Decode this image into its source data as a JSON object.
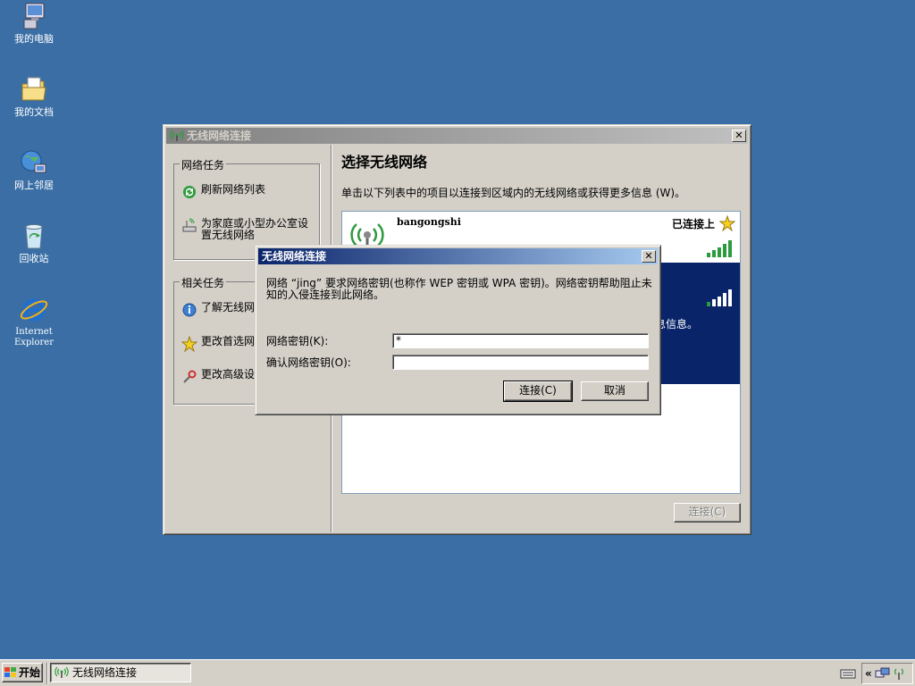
{
  "desktop": {
    "icons": [
      {
        "label": "我的电脑",
        "icon": "my-computer-icon"
      },
      {
        "label": "我的文档",
        "icon": "my-documents-icon"
      },
      {
        "label": "网上邻居",
        "icon": "network-places-icon"
      },
      {
        "label": "回收站",
        "icon": "recycle-bin-icon"
      },
      {
        "label": "Internet Explorer",
        "icon": "internet-explorer-icon"
      }
    ]
  },
  "wireless_window": {
    "title": "无线网络连接",
    "network_tasks": {
      "title": "网络任务",
      "items": [
        {
          "label": "刷新网络列表",
          "icon": "refresh-icon"
        },
        {
          "label": "为家庭或小型办公室设置无线网络",
          "icon": "setup-network-icon"
        }
      ]
    },
    "related_tasks": {
      "title": "相关任务",
      "items": [
        {
          "label": "了解无线网",
          "icon": "info-icon"
        },
        {
          "label": "更改首选网",
          "icon": "star-icon"
        },
        {
          "label": "更改高级设",
          "icon": "settings-icon"
        }
      ]
    },
    "heading": "选择无线网络",
    "instructions": "单击以下列表中的项目以连接到区域内的无线网络或获得更多信息 (W)。",
    "networks": [
      {
        "ssid": "bangongshi",
        "status": "已连接上"
      },
      {
        "partial_text": "息信息。"
      }
    ],
    "connect_button": "连接(C)"
  },
  "key_dialog": {
    "title": "无线网络连接",
    "message": "网络 “jing” 要求网络密钥(也称作 WEP 密钥或 WPA 密钥)。网络密钥帮助阻止未知的入侵连接到此网络。",
    "key_label": "网络密钥(K):",
    "key_value": "*",
    "confirm_label": "确认网络密钥(O):",
    "confirm_value": "",
    "connect_button": "连接(C)",
    "cancel_button": "取消"
  },
  "taskbar": {
    "start_label": "开始",
    "task_button": "无线网络连接"
  }
}
